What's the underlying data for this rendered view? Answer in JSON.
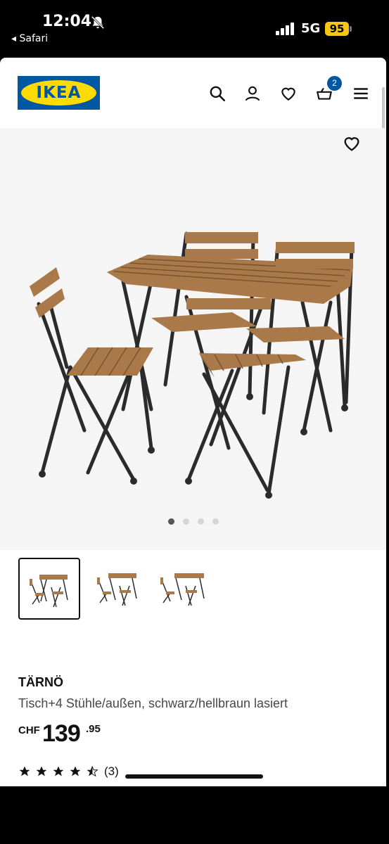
{
  "status": {
    "time": "12:04",
    "back_label": "◂ Safari",
    "network": "5G",
    "battery": "95"
  },
  "header": {
    "logo_text": "IKEA",
    "cart_count": "2"
  },
  "product": {
    "name": "TÄRNÖ",
    "description": "Tisch+4 Stühle/außen, schwarz/hellbraun lasiert",
    "price_currency": "CHF",
    "price_integer": "139",
    "price_decimal": ".95",
    "rating": 4.5,
    "rating_count": "(3)"
  },
  "gallery": {
    "image_count": 4,
    "active_index": 0,
    "thumbnail_count": 3
  },
  "colors": {
    "brand_blue": "#0058a3",
    "brand_yellow": "#ffdb00",
    "wood": "#a9794a",
    "metal": "#2b2b2b"
  }
}
